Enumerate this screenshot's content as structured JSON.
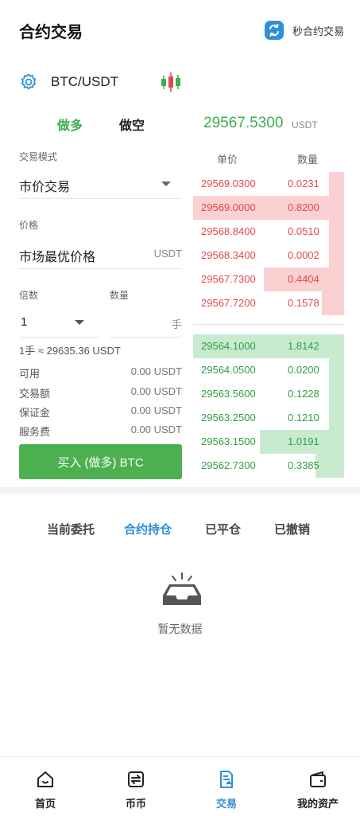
{
  "header": {
    "title": "合约交易",
    "quick_trade_label": "秒合约交易"
  },
  "pair": {
    "name": "BTC/USDT"
  },
  "side_tabs": {
    "long": "做多",
    "short": "做空"
  },
  "last_price": {
    "value": "29567.5300",
    "unit": "USDT"
  },
  "form": {
    "mode_label": "交易模式",
    "mode_value": "市价交易",
    "price_label": "价格",
    "price_value": "市场最优价格",
    "price_unit": "USDT",
    "leverage_label": "倍数",
    "leverage_value": "1",
    "qty_label": "数量",
    "qty_unit": "手",
    "lot_info": "1手 ≈ 29635.36 USDT"
  },
  "account": {
    "rows": [
      {
        "label": "可用",
        "value": "0.00 USDT"
      },
      {
        "label": "交易额",
        "value": "0.00 USDT"
      },
      {
        "label": "保证金",
        "value": "0.00 USDT"
      },
      {
        "label": "服务费",
        "value": "0.00 USDT"
      }
    ]
  },
  "buy_button": "买入 (做多) BTC",
  "orderbook": {
    "col_price": "单价",
    "col_qty": "数量",
    "asks": [
      {
        "price": "29569.0300",
        "qty": "0.0231",
        "depth": 0.1
      },
      {
        "price": "29569.0000",
        "qty": "0.8200",
        "depth": 1.0
      },
      {
        "price": "29568.8400",
        "qty": "0.0510",
        "depth": 0.1
      },
      {
        "price": "29568.3400",
        "qty": "0.0002",
        "depth": 0.1
      },
      {
        "price": "29567.7300",
        "qty": "0.4404",
        "depth": 0.53
      },
      {
        "price": "29567.7200",
        "qty": "0.1578",
        "depth": 0.15
      }
    ],
    "bids": [
      {
        "price": "29564.1000",
        "qty": "1.8142",
        "depth": 1.0
      },
      {
        "price": "29564.0500",
        "qty": "0.0200",
        "depth": 0.1
      },
      {
        "price": "29563.5600",
        "qty": "0.1228",
        "depth": 0.1
      },
      {
        "price": "29563.2500",
        "qty": "0.1210",
        "depth": 0.1
      },
      {
        "price": "29563.1500",
        "qty": "1.0191",
        "depth": 0.56
      },
      {
        "price": "29562.7300",
        "qty": "0.3385",
        "depth": 0.19
      }
    ]
  },
  "order_tabs": [
    "当前委托",
    "合约持仓",
    "已平仓",
    "已撤销"
  ],
  "order_tab_active": "合约持仓",
  "empty_text": "暂无数据",
  "nav": [
    "首页",
    "币币",
    "交易",
    "我的资产"
  ],
  "nav_active": "交易",
  "colors": {
    "accent": "#2f8fd8",
    "up": "#4caf50",
    "down": "#e5484d"
  }
}
